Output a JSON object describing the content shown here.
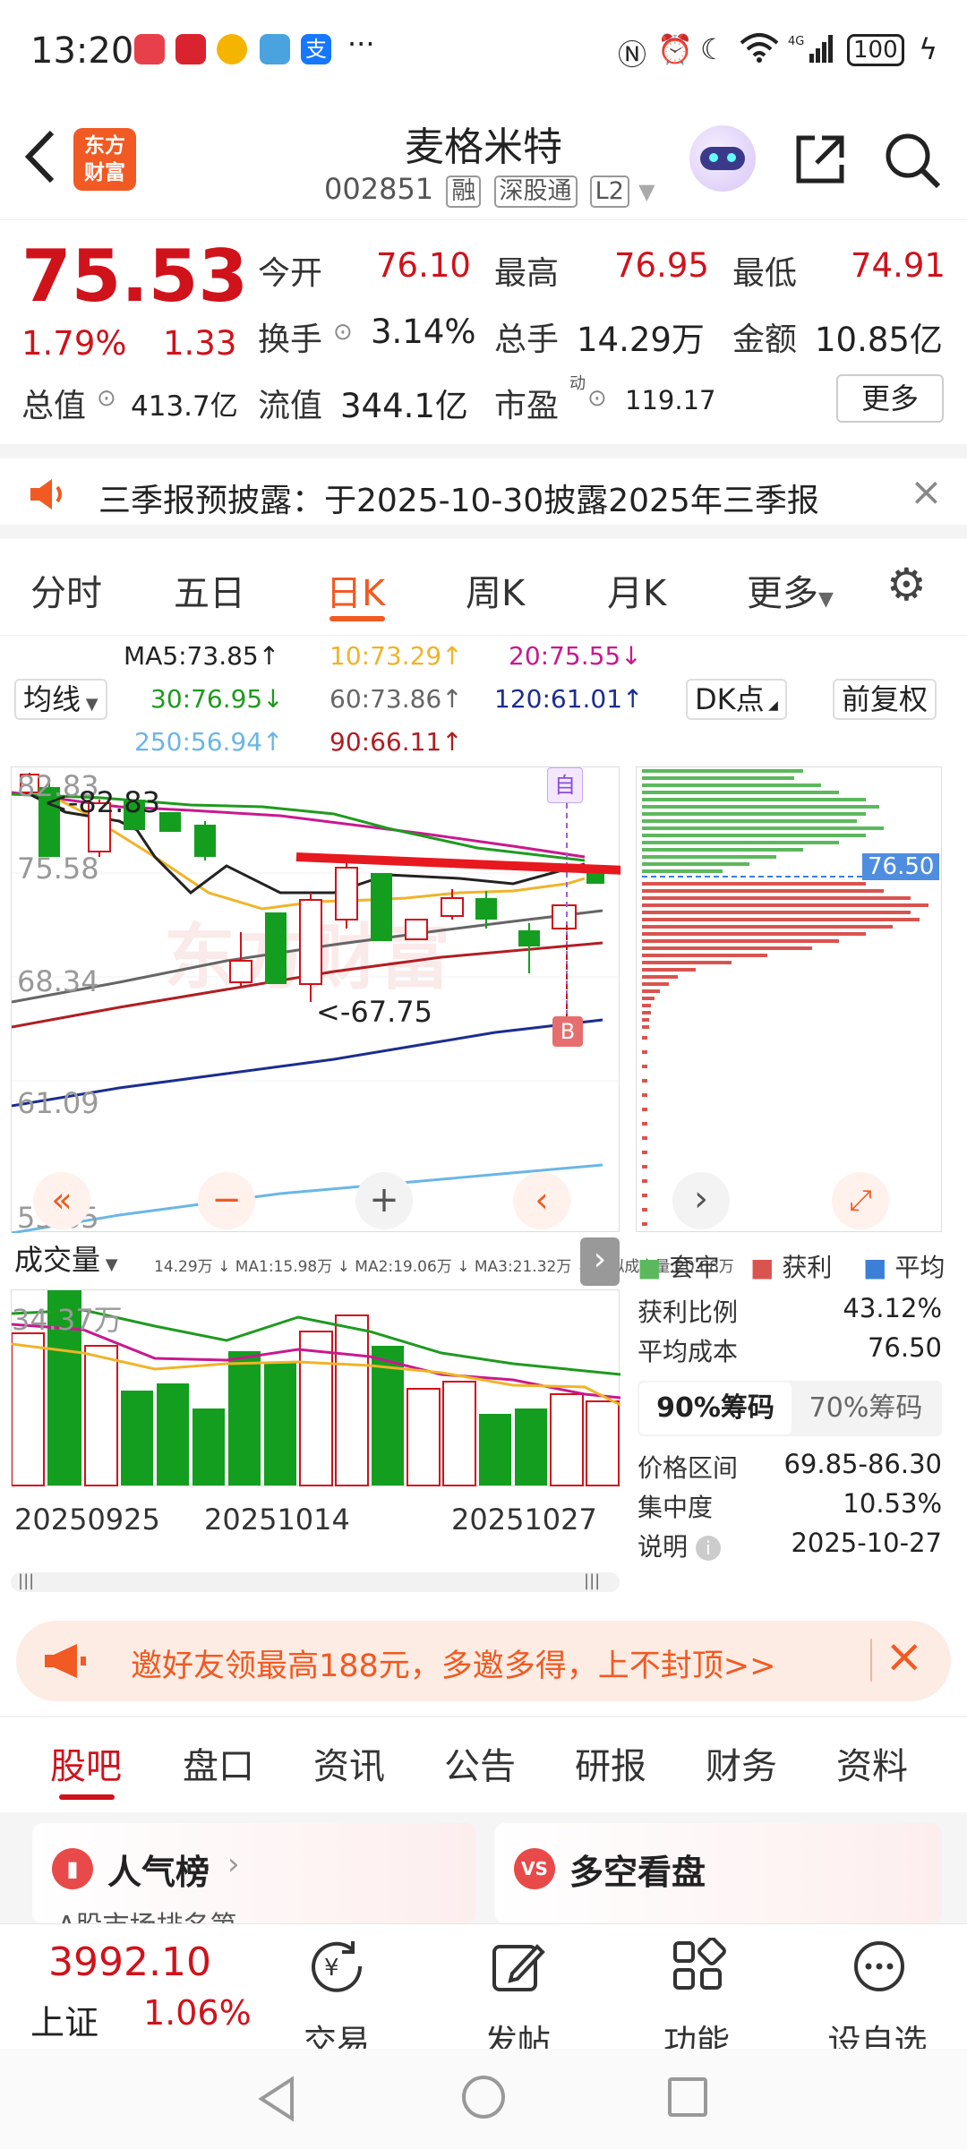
{
  "status_bar": {
    "time": "13:20",
    "battery": "100"
  },
  "header": {
    "logo_text_1": "东方",
    "logo_text_2": "财富",
    "stock_name": "麦格米特",
    "stock_code": "002851",
    "tags": [
      "融",
      "深股通",
      "L2"
    ]
  },
  "quote": {
    "price": "75.53",
    "change_pct": "1.79%",
    "change_abs": "1.33",
    "fields": [
      {
        "label": "今开",
        "value": "76.10"
      },
      {
        "label": "最高",
        "value": "76.95"
      },
      {
        "label": "最低",
        "value": "74.91"
      },
      {
        "label": "换手",
        "value": "3.14%"
      },
      {
        "label": "总手",
        "value": "14.29万"
      },
      {
        "label": "金额",
        "value": "10.85亿"
      },
      {
        "label": "总值",
        "value": "413.7亿"
      },
      {
        "label": "流值",
        "value": "344.1亿"
      },
      {
        "label": "市盈",
        "value": "119.17"
      }
    ],
    "pe_superscript": "动",
    "more_label": "更多"
  },
  "notice": {
    "text": "三季报预披露：于2025-10-30披露2025年三季报"
  },
  "period_tabs": [
    "分时",
    "五日",
    "日K",
    "周K",
    "月K",
    "更多"
  ],
  "active_tab": "日K",
  "ma_indicators": {
    "select_label": "均线",
    "ma5": "MA5:73.85",
    "ma10": "10:73.29",
    "ma20": "20:75.55",
    "ma30": "30:76.95",
    "ma60": "60:73.86",
    "ma120": "120:61.01",
    "ma250": "250:56.94",
    "ma90": "90:66.11",
    "dk_label": "DK点",
    "adjust_label": "前复权"
  },
  "colors": {
    "up": "#d0121b",
    "down": "#149e1f",
    "accent": "#f15a22",
    "ma5": "#222222",
    "ma10": "#f0b429",
    "ma20": "#c8198f",
    "ma30": "#1f9a1f",
    "ma60": "#666666",
    "ma120": "#1b2d8e",
    "ma250": "#6ab6e6",
    "ma90": "#b01e23"
  },
  "kchart": {
    "y_ticks": [
      "82.83",
      "75.58",
      "68.34",
      "61.09",
      "53.85"
    ],
    "high_label": "<-82.83",
    "low_label": "<-67.75",
    "self_marker": "自",
    "buy_marker": "B",
    "current_price_tag": "76.50"
  },
  "volume": {
    "select_label": "成交量",
    "indicators": "14.29万 ↓ MA1:15.98万 ↓ MA2:19.06万 ↓ MA3:21.32万 ↓ 虚拟成交量:20.68万",
    "max_label": "34.37万",
    "dates": [
      "20250925",
      "20251014",
      "20251027"
    ]
  },
  "chip_panel": {
    "legend": [
      "套牢",
      "获利",
      "平均"
    ],
    "profit_ratio_label": "获利比例",
    "profit_ratio": "43.12%",
    "avg_cost_label": "平均成本",
    "avg_cost": "76.50",
    "tab_90": "90%筹码",
    "tab_70": "70%筹码",
    "range_label": "价格区间",
    "range": "69.85-86.30",
    "concentration_label": "集中度",
    "concentration": "10.53%",
    "note_label": "说明",
    "note_date": "2025-10-27"
  },
  "promo": {
    "text": "邀好友领最高188元，多邀多得，上不封顶>>"
  },
  "bottom_tabs": [
    "股吧",
    "盘口",
    "资讯",
    "公告",
    "研报",
    "财务",
    "资料"
  ],
  "cards": {
    "left_title": "人气榜",
    "left_sub": "A股市场排名第",
    "right_title": "多空看盘"
  },
  "index_bar": {
    "value": "3992.10",
    "name": "上证",
    "change": "1.06%"
  },
  "bottom_nav": [
    "交易",
    "发帖",
    "功能",
    "设自选"
  ]
}
